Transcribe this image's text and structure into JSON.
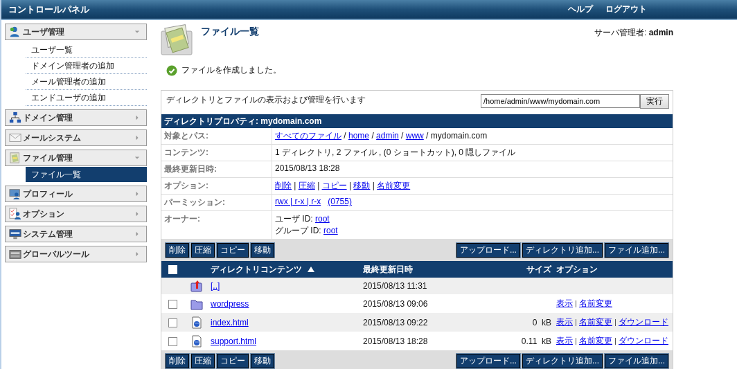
{
  "header": {
    "title": "コントロールパネル",
    "links": [
      "ヘルプ",
      "ログアウト"
    ]
  },
  "sidebar": {
    "sections": [
      {
        "label": "ユーザ管理",
        "expanded": true,
        "items": [
          {
            "label": "ユーザ一覧",
            "selected": false
          },
          {
            "label": "ドメイン管理者の追加",
            "selected": false
          },
          {
            "label": "メール管理者の追加",
            "selected": false
          },
          {
            "label": "エンドユーザの追加",
            "selected": false
          }
        ]
      },
      {
        "label": "ドメイン管理",
        "expanded": false
      },
      {
        "label": "メールシステム",
        "expanded": false
      },
      {
        "label": "ファイル管理",
        "expanded": true,
        "items": [
          {
            "label": "ファイル一覧",
            "selected": true
          }
        ]
      },
      {
        "label": "プロフィール",
        "expanded": false
      },
      {
        "label": "オプション",
        "expanded": false
      },
      {
        "label": "システム管理",
        "expanded": false
      },
      {
        "label": "グローバルツール",
        "expanded": false
      }
    ]
  },
  "page": {
    "title": "ファイル一覧",
    "user": "サーバ管理者: **admin**",
    "message": "ファイルを作成しました。"
  },
  "panel": {
    "description": "ディレクトリとファイルの表示および管理を行います",
    "path": "/home/admin/www/mydomain.com",
    "go_button": "実行",
    "heading": "ディレクトリプロパティ: mydomain.com",
    "properties": [
      {
        "label": "対象とパス:",
        "lines": [
          [
            {
              "text": "すべてのファイル",
              "link": true
            },
            {
              "text": " / ",
              "link": false
            },
            {
              "text": "home",
              "link": true
            },
            {
              "text": " / ",
              "link": false
            },
            {
              "text": "admin",
              "link": true
            },
            {
              "text": " / ",
              "link": false
            },
            {
              "text": "www",
              "link": true
            },
            {
              "text": " / mydomain.com",
              "link": false
            }
          ]
        ]
      },
      {
        "label": "コンテンツ:",
        "lines": [
          [
            {
              "text": "1 ディレクトリ, 2 ファイル , (0 ショートカット), 0 隠しファイル",
              "link": false
            }
          ]
        ]
      },
      {
        "label": "最終更新日時:",
        "lines": [
          [
            {
              "text": "2015/08/13 18:28",
              "link": false
            }
          ]
        ]
      },
      {
        "label": "オプション:",
        "lines": [
          [
            {
              "text": "削除",
              "link": true
            },
            {
              "text": " | ",
              "link": false
            },
            {
              "text": "圧縮",
              "link": true
            },
            {
              "text": " | ",
              "link": false
            },
            {
              "text": "コピー",
              "link": true
            },
            {
              "text": " | ",
              "link": false
            },
            {
              "text": "移動",
              "link": true
            },
            {
              "text": " | ",
              "link": false
            },
            {
              "text": "名前変更",
              "link": true
            }
          ]
        ]
      },
      {
        "label": "パーミッション:",
        "lines": [
          [
            {
              "text": "rwx | r-x | r-x",
              "link": true
            },
            {
              "text": "(0755)",
              "link": true
            }
          ]
        ]
      },
      {
        "label": "オーナー:",
        "lines": [
          [
            {
              "text": "ユーザ ID: ",
              "link": false
            },
            {
              "text": "root",
              "link": true
            }
          ],
          [
            {
              "text": "グループ ID: ",
              "link": false
            },
            {
              "text": "root",
              "link": true
            }
          ]
        ]
      }
    ],
    "actions_left": [
      "削除",
      "圧縮",
      "コピー",
      "移動"
    ],
    "actions_right": [
      "アップロード...",
      "ディレクトリ追加...",
      "ファイル追加..."
    ],
    "table": {
      "select_all": {
        "checked": false
      },
      "columns": [
        "ディレクトリコンテンツ",
        "最終更新日時",
        "サイズ",
        "オプション"
      ],
      "sort_ascending": true,
      "rows": [
        {
          "kind": "parent",
          "name": "[..]",
          "modified": "2015/08/13 11:31"
        },
        {
          "kind": "folder",
          "name": "wordpress",
          "modified": "2015/08/13 09:06",
          "checked": false,
          "options": [
            "表示",
            "名前変更"
          ]
        },
        {
          "kind": "file",
          "name": "index.html",
          "modified": "2015/08/13 09:22",
          "size": "0  kB",
          "checked": false,
          "options": [
            "表示",
            "名前変更",
            "ダウンロード"
          ]
        },
        {
          "kind": "file",
          "name": "support.html",
          "modified": "2015/08/13 18:28",
          "size": "0.11  kB",
          "checked": false,
          "options": [
            "表示",
            "名前変更",
            "ダウンロード"
          ]
        }
      ]
    },
    "actions_left_bottom": [
      "削除",
      "圧縮",
      "コピー",
      "移動"
    ],
    "actions_right_bottom": [
      "アップロード...",
      "ディレクトリ追加...",
      "ファイル追加..."
    ]
  }
}
